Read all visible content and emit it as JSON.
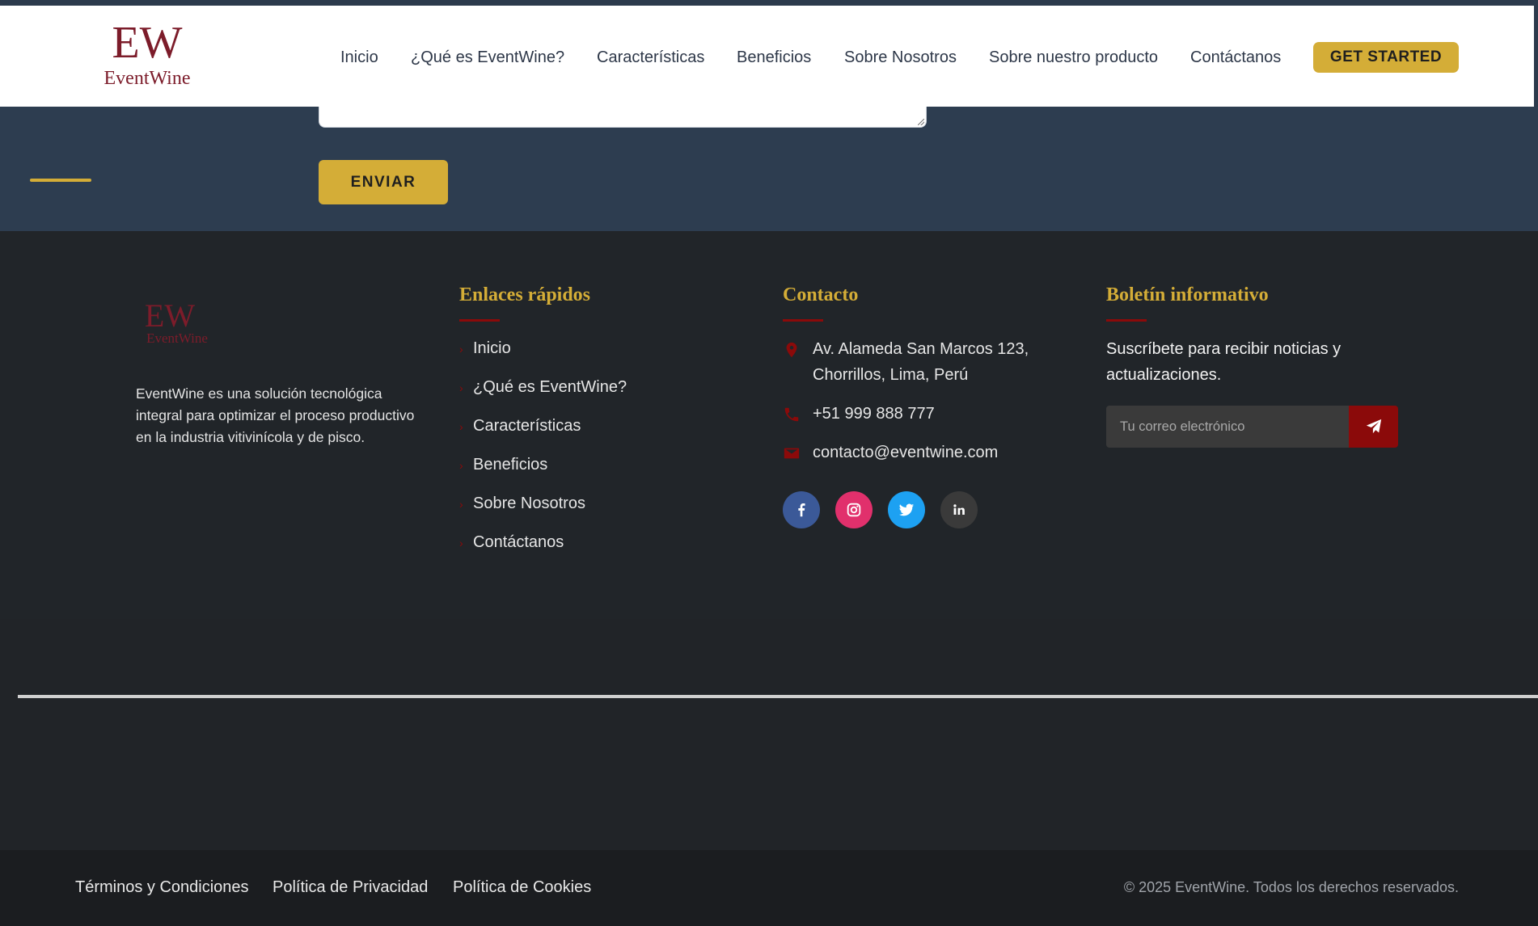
{
  "brand": {
    "name": "EventWine",
    "monogram": "EW"
  },
  "colors": {
    "accent_gold": "#d4ad37",
    "wine_red": "#8b0a0a",
    "logo_burgundy": "#7c1c2a",
    "contact_bg": "#2d3d50",
    "footer_bg": "#212529"
  },
  "navbar": {
    "links": [
      "Inicio",
      "¿Qué es EventWine?",
      "Características",
      "Beneficios",
      "Sobre Nosotros",
      "Sobre nuestro producto",
      "Contáctanos"
    ],
    "cta_label": "GET STARTED"
  },
  "contact_form": {
    "submit_label": "ENVIAR"
  },
  "footer": {
    "about_text": "EventWine es una solución tecnológica integral para optimizar el proceso productivo en la industria vitivinícola y de pisco.",
    "quick_links": {
      "title": "Enlaces rápidos",
      "items": [
        "Inicio",
        "¿Qué es EventWine?",
        "Características",
        "Beneficios",
        "Sobre Nosotros",
        "Contáctanos"
      ]
    },
    "contact": {
      "title": "Contacto",
      "address": "Av. Alameda San Marcos 123, Chorrillos, Lima, Perú",
      "phone": "+51 999 888 777",
      "email": "contacto@eventwine.com",
      "icons": [
        "location-pin-icon",
        "phone-icon",
        "envelope-icon"
      ],
      "socials": [
        {
          "name": "facebook",
          "icon": "facebook-icon",
          "color": "#3b5998"
        },
        {
          "name": "instagram",
          "icon": "instagram-icon",
          "color": "#e1306c"
        },
        {
          "name": "twitter",
          "icon": "twitter-icon",
          "color": "#1da1f2"
        },
        {
          "name": "linkedin",
          "icon": "linkedin-icon",
          "color": "#3a3a3a"
        }
      ]
    },
    "newsletter": {
      "title": "Boletín informativo",
      "description": "Suscríbete para recibir noticias y actualizaciones.",
      "placeholder": "Tu correo electrónico",
      "send_icon": "paper-plane-icon"
    }
  },
  "bottom_bar": {
    "links": [
      "Términos y Condiciones",
      "Política de Privacidad",
      "Política de Cookies"
    ],
    "copyright": "© 2025 EventWine. Todos los derechos reservados."
  }
}
